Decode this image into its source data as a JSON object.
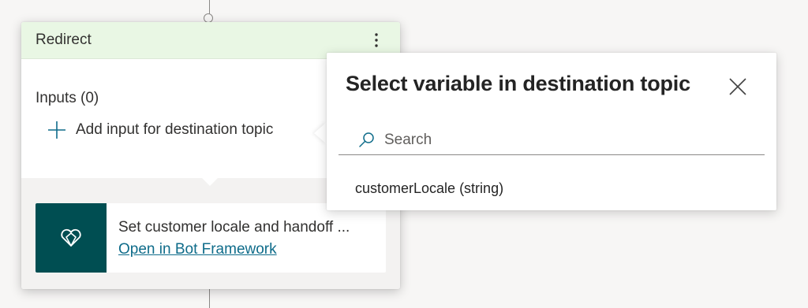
{
  "redirect_node": {
    "title": "Redirect",
    "more_icon": "more-vertical-icon",
    "inputs_label": "Inputs (0)",
    "add_input_label": "Add input for destination topic",
    "topic": {
      "title": "Set customer locale and handoff ...",
      "link_label": "Open in Bot Framework",
      "icon": "bot-framework-icon",
      "icon_background": "#004e52"
    }
  },
  "variable_picker": {
    "title": "Select variable in destination topic",
    "close_icon": "close-icon",
    "search": {
      "placeholder": "Search",
      "value": ""
    },
    "items": [
      {
        "label": "customerLocale (string)"
      }
    ]
  },
  "colors": {
    "header_background": "#e9f7e4",
    "accent": "#0f6c8a",
    "canvas": "#f7f6f5"
  }
}
